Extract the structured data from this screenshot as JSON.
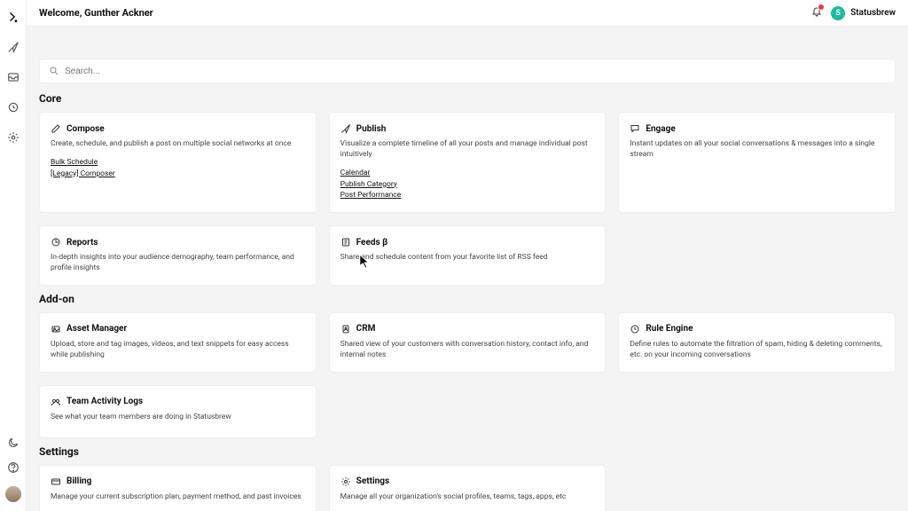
{
  "topbar": {
    "title": "Welcome, Gunther Ackner",
    "org_name": "Statusbrew",
    "org_initial": "S"
  },
  "search": {
    "placeholder": "Search..."
  },
  "sections": {
    "core_label": "Core",
    "addon_label": "Add-on",
    "settings_label": "Settings"
  },
  "cards": {
    "compose": {
      "title": "Compose",
      "desc": "Create, schedule, and publish a post on multiple social networks at once",
      "link1": "Bulk Schedule",
      "link2": "[Legacy] Composer"
    },
    "publish": {
      "title": "Publish",
      "desc": "Visualize a complete timeline of all your posts and manage individual post intuitively",
      "link1": "Calendar",
      "link2": "Publish Category",
      "link3": "Post Performance"
    },
    "engage": {
      "title": "Engage",
      "desc": "Instant updates on all your social conversations & messages into a single stream"
    },
    "reports": {
      "title": "Reports",
      "desc": "In-depth insights into your audience demography, team performance, and profile insights"
    },
    "feeds": {
      "title": "Feeds β",
      "desc": "Share and schedule content from your favorite list of RSS feed"
    },
    "asset": {
      "title": "Asset Manager",
      "desc": "Upload, store and tag images, videos, and text snippets for easy access while publishing"
    },
    "crm": {
      "title": "CRM",
      "desc": "Shared view of your customers with conversation history, contact info, and internal notes"
    },
    "rule": {
      "title": "Rule Engine",
      "desc": "Define rules to automate the filtration of spam, hiding & deleting comments, etc. on your incoming conversations"
    },
    "team": {
      "title": "Team Activity Logs",
      "desc": "See what your team members are doing in Statusbrew"
    },
    "billing": {
      "title": "Billing",
      "desc": "Manage your current subscription plan, payment method, and past invoices"
    },
    "settings": {
      "title": "Settings",
      "desc": "Manage all your organization's social profiles, teams, tags, apps, etc"
    }
  }
}
